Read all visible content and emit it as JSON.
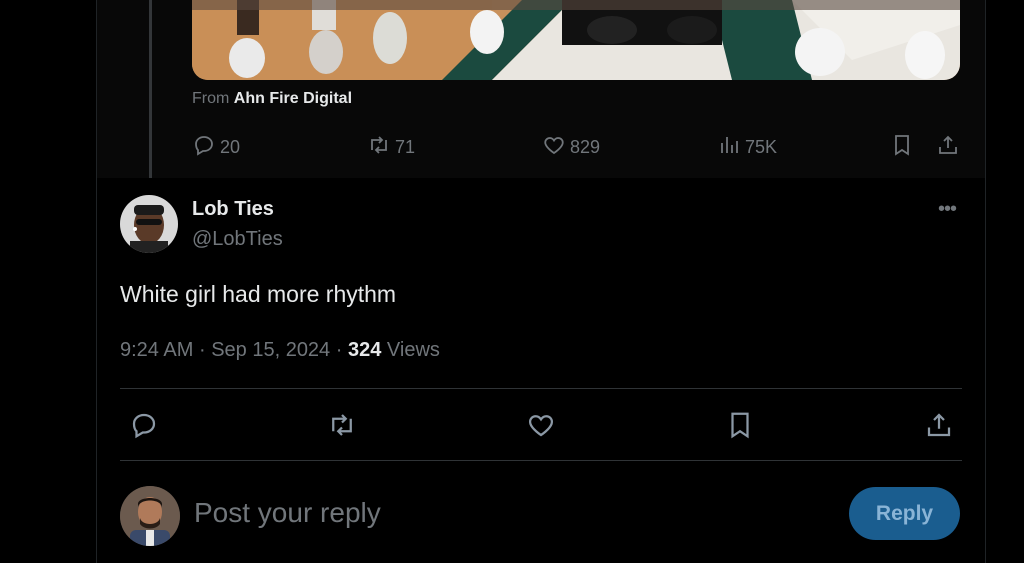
{
  "parent_tweet": {
    "from_prefix": "From",
    "from_source": "Ahn Fire Digital",
    "actions": {
      "replies": "20",
      "reposts": "71",
      "likes": "829",
      "views": "75K"
    }
  },
  "tweet": {
    "author_name": "Lob Ties",
    "author_handle": "@LobTies",
    "text": "White girl had more rhythm",
    "time": "9:24 AM",
    "date": "Sep 15, 2024",
    "separator": "·",
    "views_count": "324",
    "views_label": "Views",
    "more_label": "•••"
  },
  "composer": {
    "placeholder": "Post your reply",
    "button_label": "Reply"
  },
  "icons": {
    "reply": "reply-icon",
    "repost": "repost-icon",
    "like": "heart-icon",
    "views": "views-chart-icon",
    "bookmark": "bookmark-icon",
    "share": "share-icon"
  },
  "colors": {
    "background": "#000000",
    "text_primary": "#e7e9ea",
    "text_secondary": "#71767b",
    "divider": "#2f3336",
    "reply_button": "#1a5d8f"
  }
}
